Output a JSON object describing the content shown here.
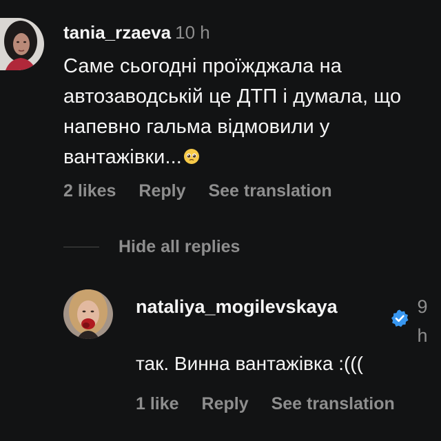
{
  "comment": {
    "username": "tania_rzaeva",
    "time": "10 h",
    "text": "Саме сьогодні проїжджала на автозаводській це ДТП і думала, що напевно гальма відмовили у вантажівки...",
    "emoji": "pleading-face-icon",
    "likes": "2 likes",
    "reply_label": "Reply",
    "translate_label": "See translation"
  },
  "hide_replies_label": "Hide all replies",
  "reply": {
    "username": "nataliya_mogilevskaya",
    "verified_icon": "verified-badge-icon",
    "time": "9 h",
    "text": "так. Винна вантажівка :(((",
    "likes": "1 like",
    "reply_label": "Reply",
    "translate_label": "See translation"
  },
  "colors": {
    "background": "#121314",
    "primary_text": "#f5f5f5",
    "secondary_text": "#8e8e8e",
    "verified": "#3897f0"
  }
}
